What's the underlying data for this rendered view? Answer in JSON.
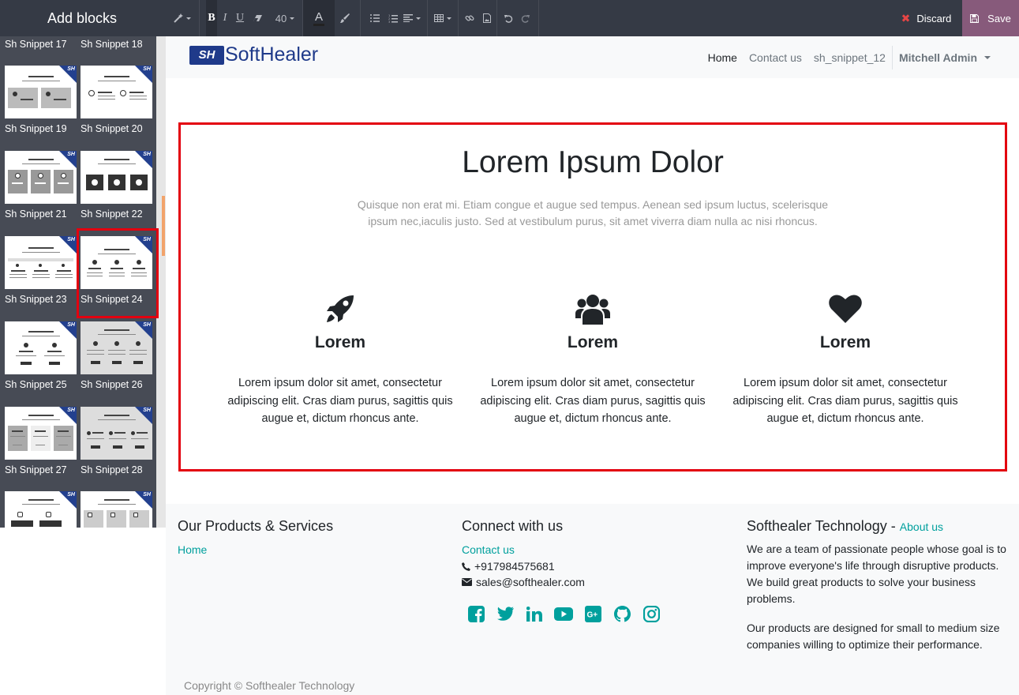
{
  "sidebar": {
    "title": "Add blocks",
    "snippets": [
      "Sh Snippet 17",
      "Sh Snippet 18",
      "Sh Snippet 19",
      "Sh Snippet 20",
      "Sh Snippet 21",
      "Sh Snippet 22",
      "Sh Snippet 23",
      "Sh Snippet 24",
      "Sh Snippet 25",
      "Sh Snippet 26",
      "Sh Snippet 27",
      "Sh Snippet 28"
    ],
    "thumb_badge": "SH",
    "selected_snippet": "Sh Snippet 24"
  },
  "toolbar": {
    "font_size": "40",
    "discard_label": "Discard",
    "save_label": "Save"
  },
  "site": {
    "logo_mark": "SH",
    "logo_text": "SoftHealer",
    "nav": {
      "home": "Home",
      "contact": "Contact us",
      "snippet": "sh_snippet_12",
      "user": "Mitchell Admin"
    }
  },
  "main": {
    "title": "Lorem Ipsum Dolor",
    "subtitle": "Quisque non erat mi. Etiam congue et augue sed tempus. Aenean sed ipsum luctus, scelerisque ipsum nec,iaculis justo. Sed at vestibulum purus, sit amet viverra diam nulla ac nisi rhoncus.",
    "features": [
      {
        "icon": "rocket-icon",
        "title": "Lorem",
        "text": "Lorem ipsum dolor sit amet, consectetur adipiscing elit. Cras diam purus, sagittis quis augue et, dictum rhoncus ante."
      },
      {
        "icon": "users-icon",
        "title": "Lorem",
        "text": "Lorem ipsum dolor sit amet, consectetur adipiscing elit. Cras diam purus, sagittis quis augue et, dictum rhoncus ante."
      },
      {
        "icon": "heart-icon",
        "title": "Lorem",
        "text": "Lorem ipsum dolor sit amet, consectetur adipiscing elit. Cras diam purus, sagittis quis augue et, dictum rhoncus ante."
      }
    ]
  },
  "footer": {
    "products_title": "Our Products & Services",
    "products_home": "Home",
    "connect_title": "Connect with us",
    "contact_link": "Contact us",
    "phone": "+917984575681",
    "email": "sales@softhealer.com",
    "company_title": "Softhealer Technology",
    "company_sep": " - ",
    "about_link": "About us",
    "about_p1": "We are a team of passionate people whose goal is to improve everyone's life through disruptive products. We build great products to solve your business problems.",
    "about_p2": "Our products are designed for small to medium size companies willing to optimize their performance.",
    "copyright": "Copyright © Softhealer Technology",
    "social_icons": [
      "facebook-icon",
      "twitter-icon",
      "linkedin-icon",
      "youtube-icon",
      "google-plus-icon",
      "github-icon",
      "instagram-icon"
    ]
  },
  "colors": {
    "accent": "#00a09d",
    "selection": "#e3000f",
    "save_button": "#875a7b",
    "toolbar_bg": "#353a45"
  }
}
